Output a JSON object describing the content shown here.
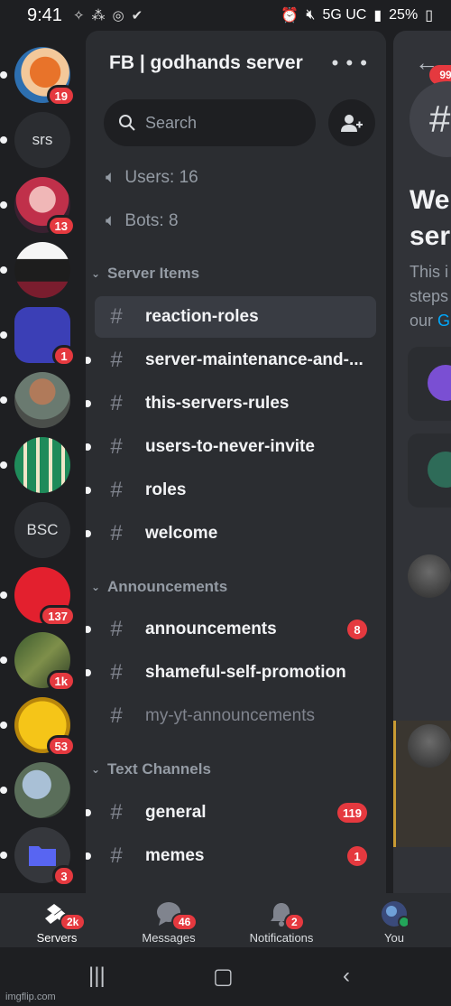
{
  "status_bar": {
    "time": "9:41",
    "network": "5G UC",
    "battery": "25%"
  },
  "servers": [
    {
      "id": "haikyuu",
      "badge": "19"
    },
    {
      "id": "srs",
      "label": "srs",
      "badge": ""
    },
    {
      "id": "red-anime",
      "badge": "13"
    },
    {
      "id": "maid-anime",
      "badge": ""
    },
    {
      "id": "blue-server",
      "badge": "1"
    },
    {
      "id": "the-rock",
      "badge": ""
    },
    {
      "id": "class-1a",
      "badge": ""
    },
    {
      "id": "bsc",
      "label": "BSC",
      "badge": ""
    },
    {
      "id": "red-axes",
      "badge": "137"
    },
    {
      "id": "meme-server",
      "badge": "1k"
    },
    {
      "id": "dollar-server",
      "badge": "53"
    },
    {
      "id": "tree-server",
      "badge": ""
    },
    {
      "id": "folder",
      "badge": "3"
    }
  ],
  "server": {
    "name": "FB | godhands server",
    "search_placeholder": "Search",
    "stats": {
      "users": "Users: 16",
      "bots": "Bots: 8"
    }
  },
  "categories": [
    {
      "name": "Server Items",
      "channels": [
        {
          "name": "reaction-roles",
          "selected": true,
          "unread": false,
          "badge": ""
        },
        {
          "name": "server-maintenance-and-...",
          "unread": true,
          "badge": ""
        },
        {
          "name": "this-servers-rules",
          "unread": true,
          "badge": ""
        },
        {
          "name": "users-to-never-invite",
          "unread": true,
          "badge": ""
        },
        {
          "name": "roles",
          "unread": true,
          "badge": ""
        },
        {
          "name": "welcome",
          "unread": true,
          "badge": ""
        }
      ]
    },
    {
      "name": "Announcements",
      "channels": [
        {
          "name": "announcements",
          "unread": true,
          "badge": "8"
        },
        {
          "name": "shameful-self-promotion",
          "unread": true,
          "badge": ""
        },
        {
          "name": "my-yt-announcements",
          "unread": false,
          "muted": true,
          "badge": ""
        }
      ]
    },
    {
      "name": "Text Channels",
      "channels": [
        {
          "name": "general",
          "unread": true,
          "badge": "119"
        },
        {
          "name": "memes",
          "unread": true,
          "badge": "1"
        }
      ]
    }
  ],
  "peek": {
    "badge": "99",
    "welcome_lines": [
      "We",
      "ser"
    ],
    "desc_lines": [
      "This i",
      "steps",
      "our"
    ],
    "desc_link": "G"
  },
  "bottom_nav": [
    {
      "label": "Servers",
      "badge": "2k",
      "icon": "servers-icon"
    },
    {
      "label": "Messages",
      "badge": "46",
      "icon": "messages-icon"
    },
    {
      "label": "Notifications",
      "badge": "2",
      "icon": "bell-icon"
    },
    {
      "label": "You",
      "badge": "",
      "icon": "avatar-icon"
    }
  ],
  "watermark": "imgflip.com",
  "colors": {
    "background": "#1e1f22",
    "panel": "#2b2d31",
    "badge": "#e5393f",
    "link": "#00a8fc"
  }
}
